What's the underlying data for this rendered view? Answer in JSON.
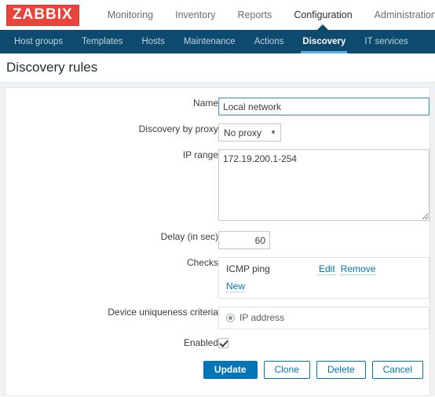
{
  "brand": {
    "logo_text": "ZABBIX",
    "logo_bg": "#e8443a"
  },
  "topnav": {
    "items": [
      {
        "label": "Monitoring",
        "active": false
      },
      {
        "label": "Inventory",
        "active": false
      },
      {
        "label": "Reports",
        "active": false
      },
      {
        "label": "Configuration",
        "active": true
      },
      {
        "label": "Administration",
        "active": false
      }
    ]
  },
  "subnav": {
    "bg": "#0e4a6e",
    "active_underline": "#55b3e8",
    "items": [
      {
        "label": "Host groups",
        "active": false
      },
      {
        "label": "Templates",
        "active": false
      },
      {
        "label": "Hosts",
        "active": false
      },
      {
        "label": "Maintenance",
        "active": false
      },
      {
        "label": "Actions",
        "active": false
      },
      {
        "label": "Discovery",
        "active": true
      },
      {
        "label": "IT services",
        "active": false
      }
    ]
  },
  "page": {
    "title": "Discovery rules"
  },
  "form": {
    "name": {
      "label": "Name",
      "value": "Local network",
      "placeholder": ""
    },
    "proxy": {
      "label": "Discovery by proxy",
      "selected": "No proxy",
      "caret": "chevron-down-icon",
      "options": [
        "No proxy"
      ]
    },
    "ip_range": {
      "label": "IP range",
      "value": "172.19.200.1-254",
      "placeholder": ""
    },
    "delay": {
      "label": "Delay (in sec)",
      "value": "60",
      "placeholder": ""
    },
    "checks": {
      "label": "Checks",
      "items": [
        {
          "name": "ICMP ping",
          "edit_label": "Edit",
          "remove_label": "Remove"
        }
      ],
      "new_label": "New"
    },
    "uniqueness": {
      "label": "Device uniqueness criteria",
      "options": [
        {
          "label": "IP address",
          "selected": true
        }
      ]
    },
    "enabled": {
      "label": "Enabled",
      "checked": true
    }
  },
  "buttons": [
    {
      "label": "Update",
      "kind": "primary"
    },
    {
      "label": "Clone",
      "kind": "secondary"
    },
    {
      "label": "Delete",
      "kind": "secondary"
    },
    {
      "label": "Cancel",
      "kind": "secondary"
    }
  ]
}
